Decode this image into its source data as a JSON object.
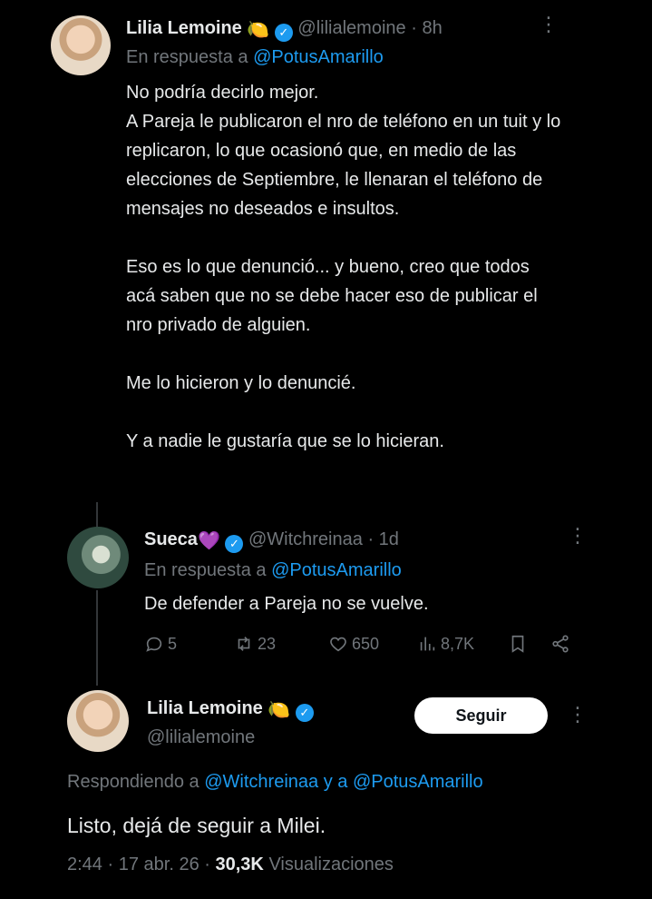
{
  "tweet1": {
    "name": "Lilia Lemoine",
    "emoji": "🍋",
    "handle": "@lilialemoine",
    "sep": "·",
    "time": "8h",
    "reply_prefix": "En respuesta a",
    "reply_to": "@PotusAmarillo",
    "text": "No podría decirlo mejor.\nA Pareja le publicaron el nro de teléfono en un tuit y lo replicaron, lo que ocasionó que, en medio de las elecciones de Septiembre, le llenaran el teléfono de mensajes no deseados e insultos.\n\nEso es lo que denunció... y bueno, creo que todos acá saben que no se debe hacer eso de publicar el nro privado de alguien.\n\nMe lo hicieron y lo denuncié.\n\nY a nadie le gustaría que se lo hicieran."
  },
  "tweet2": {
    "name": "Sueca",
    "emoji": "💜",
    "handle": "@Witchreinaa",
    "sep": "·",
    "time": "1d",
    "reply_prefix": "En respuesta a",
    "reply_to": "@PotusAmarillo",
    "text": "De defender a Pareja no se vuelve.",
    "actions": {
      "replies": "5",
      "retweets": "23",
      "likes": "650",
      "views": "8,7K"
    }
  },
  "tweet3": {
    "name": "Lilia Lemoine",
    "emoji": "🍋",
    "handle": "@lilialemoine",
    "follow_label": "Seguir",
    "reply_prefix": "Respondiendo a",
    "reply_to": "@Witchreinaa y a @PotusAmarillo",
    "text": "Listo, dejá de seguir a Milei.",
    "time": "2:44",
    "date": "17 abr. 26",
    "views_count": "30,3K",
    "views_label": "Visualizaciones"
  },
  "colors": {
    "background": "#000000",
    "text": "#e7e9ea",
    "secondary": "#71767b",
    "link": "#1d9bf0",
    "verified": "#1d9bf0"
  }
}
